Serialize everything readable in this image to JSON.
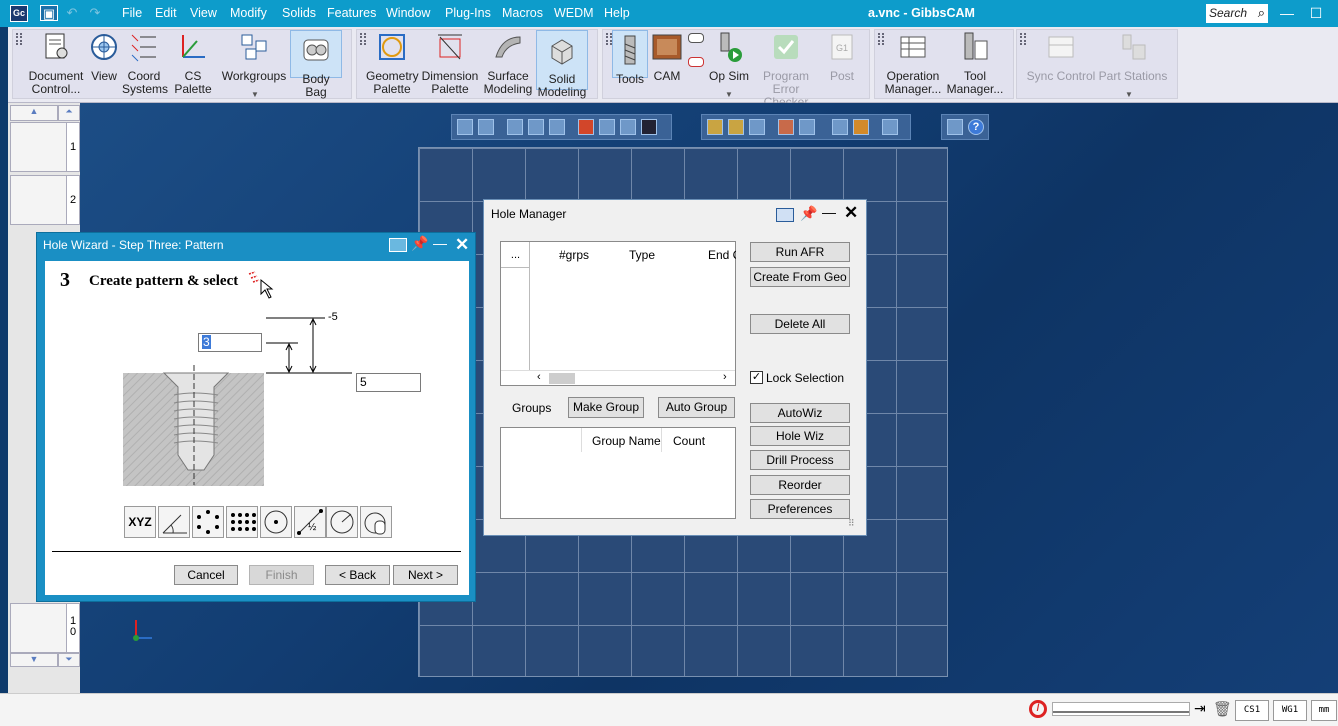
{
  "titlebar": {
    "logo": "Gc",
    "menu": [
      "File",
      "Edit",
      "View",
      "Modify",
      "Solids",
      "Features",
      "Window",
      "Plug-Ins",
      "Macros",
      "WEDM",
      "Help"
    ],
    "title": "a.vnc - GibbsCAM",
    "search_placeholder": "Search",
    "minimize": "—",
    "maximize": "☐"
  },
  "toolbar": {
    "document_control": [
      "Document",
      "Control..."
    ],
    "view": "View",
    "coord_systems": [
      "Coord",
      "Systems"
    ],
    "cs_palette": "CS Palette",
    "workgroups": "Workgroups",
    "body_bag": "Body Bag",
    "geometry_palette": [
      "Geometry",
      "Palette"
    ],
    "dimension_palette": [
      "Dimension",
      "Palette"
    ],
    "surface_modeling": [
      "Surface",
      "Modeling"
    ],
    "solid_modeling": [
      "Solid",
      "Modeling"
    ],
    "tools": "Tools",
    "cam": "CAM",
    "op_sim": "Op Sim",
    "program_error_checker": [
      "Program",
      "Error Checker"
    ],
    "post": "Post",
    "operation_manager": [
      "Operation",
      "Manager..."
    ],
    "tool_manager": [
      "Tool",
      "Manager..."
    ],
    "sync_control": "Sync Control",
    "part_stations": "Part Stations"
  },
  "left_strip": {
    "tabs": [
      "1",
      "2"
    ],
    "bottom_tab": [
      "1",
      "0"
    ]
  },
  "hole_wizard": {
    "title": "Hole Wizard - Step Three: Pattern",
    "step_number": "3",
    "step_text": "Create pattern & select",
    "dim_top": "-5",
    "depth_value": "3",
    "diameter_value": "5",
    "pattern_xyz": "XYZ",
    "pattern_half": "½",
    "buttons": {
      "cancel": "Cancel",
      "finish": "Finish",
      "back": "< Back",
      "next": "Next >"
    }
  },
  "hole_manager": {
    "title": "Hole Manager",
    "table_headers": [
      "...",
      "#grps",
      "Type",
      "End C"
    ],
    "groups_label": "Groups",
    "make_group": "Make Group",
    "auto_group": "Auto Group",
    "group_headers": [
      "Group Name",
      "Count"
    ],
    "buttons": {
      "run_afr": "Run AFR",
      "create_from_geo": "Create From Geo",
      "delete_all": "Delete All",
      "autowiz": "AutoWiz",
      "hole_wiz": "Hole Wiz",
      "drill_process": "Drill Process",
      "reorder": "Reorder",
      "preferences": "Preferences"
    },
    "lock_selection": "Lock Selection",
    "lock_checked": true
  },
  "statusbar": {
    "cs": "CS1",
    "wg": "WG1",
    "units": "mm"
  }
}
